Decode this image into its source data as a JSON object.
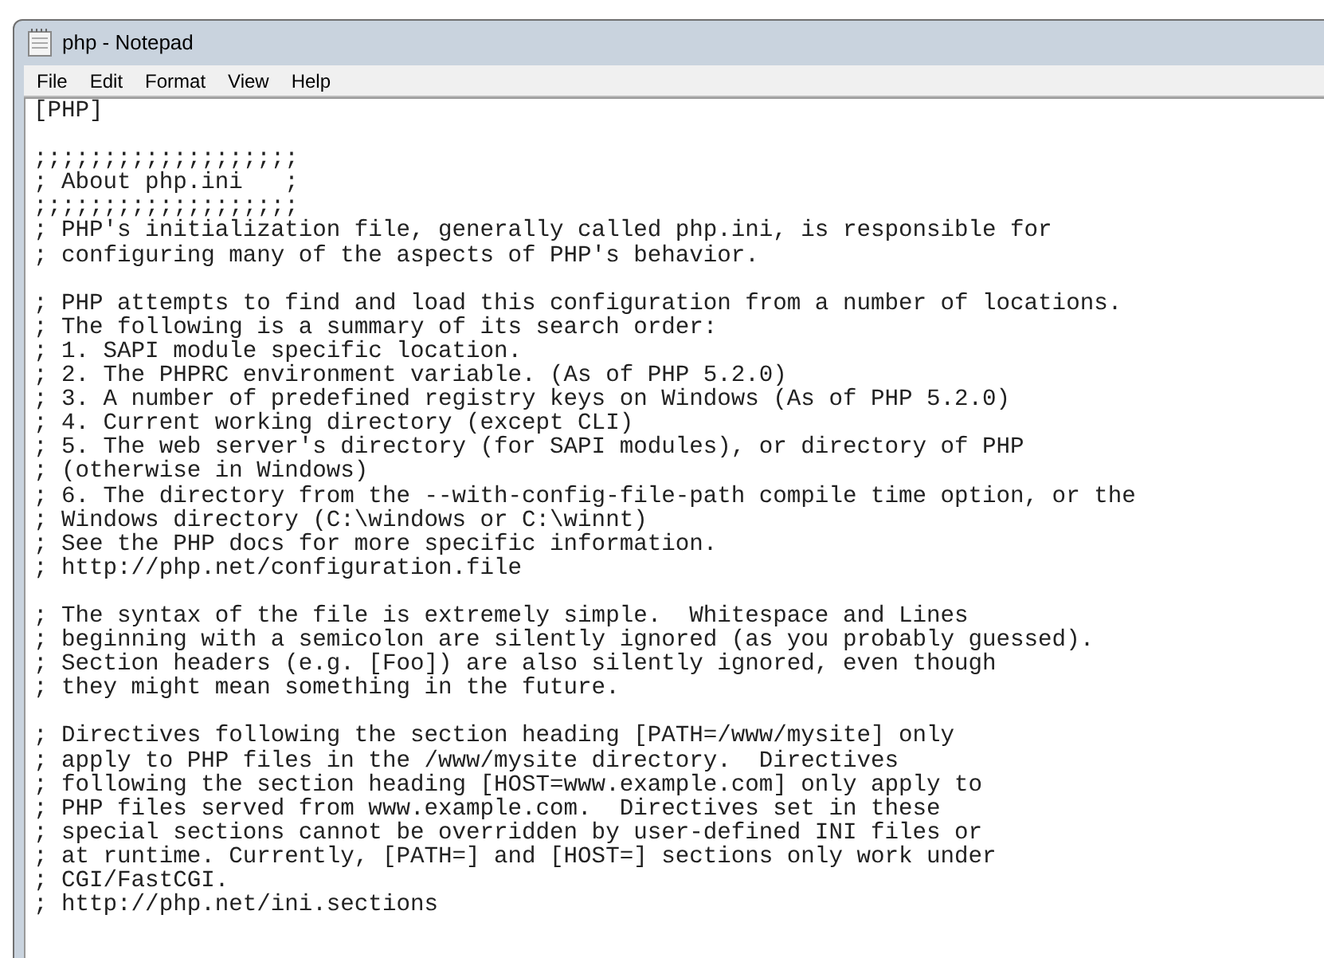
{
  "window": {
    "title": "php - Notepad"
  },
  "menu": [
    "File",
    "Edit",
    "Format",
    "View",
    "Help"
  ],
  "paragraphs": [
    {
      "lines": [
        "[PHP]"
      ]
    },
    {
      "lines": [
        ";;;;;;;;;;;;;;;;;;;",
        "; About php.ini   ;",
        ";;;;;;;;;;;;;;;;;;;",
        "; PHP's initialization file, generally called php.ini, is responsible for",
        "; configuring many of the aspects of PHP's behavior."
      ]
    },
    {
      "lines": [
        "; PHP attempts to find and load this configuration from a number of locations.",
        "; The following is a summary of its search order:",
        "; 1. SAPI module specific location.",
        "; 2. The PHPRC environment variable. (As of PHP 5.2.0)",
        "; 3. A number of predefined registry keys on Windows (As of PHP 5.2.0)",
        "; 4. Current working directory (except CLI)",
        "; 5. The web server's directory (for SAPI modules), or directory of PHP",
        "; (otherwise in Windows)",
        "; 6. The directory from the --with-config-file-path compile time option, or the",
        "; Windows directory (C:\\windows or C:\\winnt)",
        "; See the PHP docs for more specific information.",
        "; http://php.net/configuration.file"
      ]
    },
    {
      "lines": [
        "; The syntax of the file is extremely simple.  Whitespace and Lines",
        "; beginning with a semicolon are silently ignored (as you probably guessed).",
        "; Section headers (e.g. [Foo]) are also silently ignored, even though",
        "; they might mean something in the future."
      ]
    },
    {
      "lines": [
        "; Directives following the section heading [PATH=/www/mysite] only",
        "; apply to PHP files in the /www/mysite directory.  Directives",
        "; following the section heading [HOST=www.example.com] only apply to",
        "; PHP files served from www.example.com.  Directives set in these",
        "; special sections cannot be overridden by user-defined INI files or",
        "; at runtime. Currently, [PATH=] and [HOST=] sections only work under",
        "; CGI/FastCGI.",
        "; http://php.net/ini.sections"
      ]
    }
  ]
}
